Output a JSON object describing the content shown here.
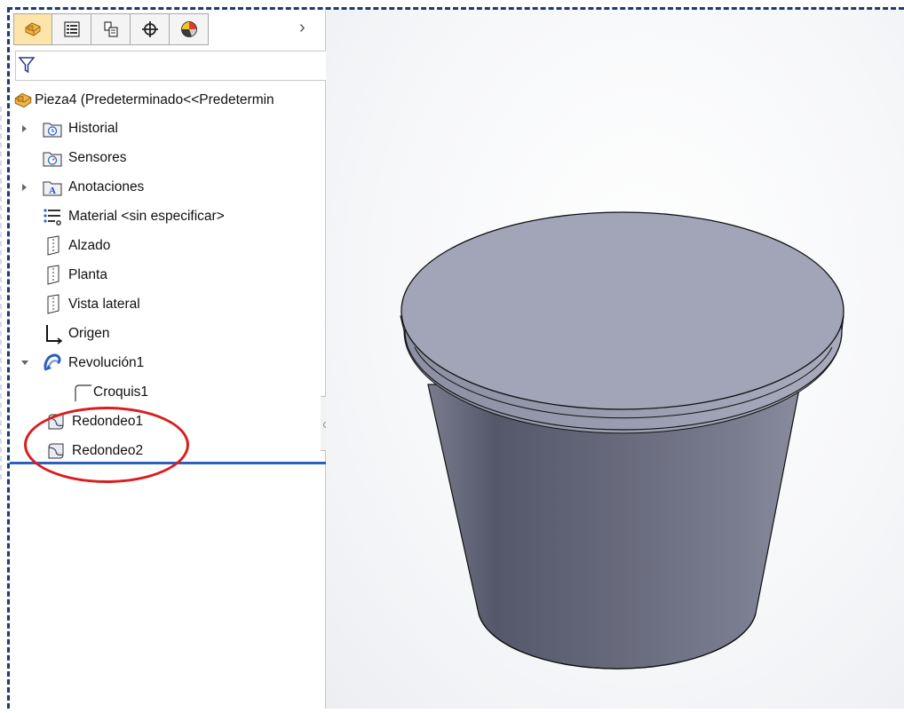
{
  "feature_manager": {
    "tabs": [
      {
        "name": "featuremanager-tab",
        "icon": "part-icon"
      },
      {
        "name": "propertymanager-tab",
        "icon": "property-list-icon"
      },
      {
        "name": "configurationmanager-tab",
        "icon": "configuration-icon"
      },
      {
        "name": "dimxpertmanager-tab",
        "icon": "crosshair-icon"
      },
      {
        "name": "displaymanager-tab",
        "icon": "appearance-sphere-icon"
      }
    ],
    "more_tabs_glyph": "›",
    "root": "Pieza4  (Predeterminado<<Predetermin",
    "items": [
      {
        "label": "Historial",
        "icon": "history-folder-icon",
        "expandable": true
      },
      {
        "label": "Sensores",
        "icon": "sensors-folder-icon",
        "expandable": false
      },
      {
        "label": "Anotaciones",
        "icon": "annotations-folder-icon",
        "expandable": true
      },
      {
        "label": "Material <sin especificar>",
        "icon": "material-icon",
        "expandable": false
      },
      {
        "label": "Alzado",
        "icon": "plane-icon",
        "expandable": false
      },
      {
        "label": "Planta",
        "icon": "plane-icon",
        "expandable": false
      },
      {
        "label": "Vista lateral",
        "icon": "plane-icon",
        "expandable": false
      },
      {
        "label": "Origen",
        "icon": "origin-icon",
        "expandable": false
      },
      {
        "label": "Revolución1",
        "icon": "revolve-icon",
        "expandable": true,
        "expanded": true
      },
      {
        "label": "Croquis1",
        "icon": "sketch-icon",
        "expandable": false,
        "child": true
      },
      {
        "label": "Redondeo1",
        "icon": "fillet-icon",
        "expandable": false,
        "highlighted": true
      },
      {
        "label": "Redondeo2",
        "icon": "fillet-icon",
        "expandable": false,
        "highlighted": true
      }
    ]
  },
  "colors": {
    "annotation_circle": "#d81e1e",
    "rollback_bar": "#2f5fbf",
    "frame_dash": "#1e3a6e",
    "model_top": "#a2a4b8",
    "model_side": "#6c6e80"
  }
}
